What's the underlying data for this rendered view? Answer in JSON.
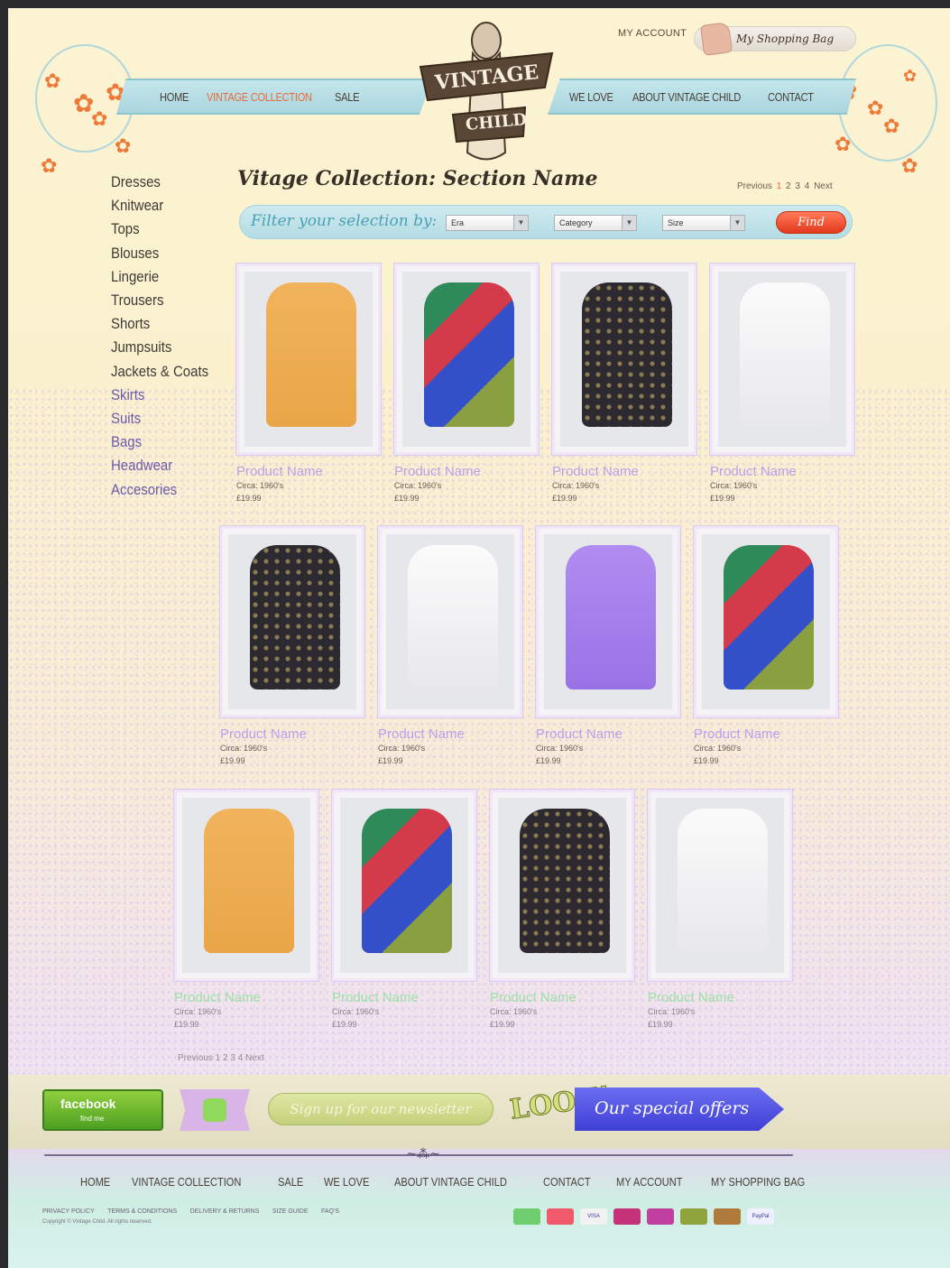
{
  "header": {
    "my_account": "MY ACCOUNT",
    "shopping_bag": "My Shopping Bag",
    "logo_top": "VINTAGE",
    "logo_bottom": "CHILD"
  },
  "nav_left": [
    {
      "label": "HOME",
      "active": false
    },
    {
      "label": "VINTAGE COLLECTION",
      "active": true
    },
    {
      "label": "SALE",
      "active": false
    }
  ],
  "nav_right": [
    {
      "label": "WE LOVE"
    },
    {
      "label": "ABOUT VINTAGE CHILD"
    },
    {
      "label": "CONTACT"
    }
  ],
  "sidebar": {
    "items": [
      "Dresses",
      "Knitwear",
      "Tops",
      "Blouses",
      "Lingerie",
      "Trousers",
      "Shorts",
      "Jumpsuits",
      "Jackets & Coats",
      "Skirts",
      "Suits",
      "Bags",
      "Headwear",
      "Accesories"
    ]
  },
  "main": {
    "title": "Vitage Collection: Section Name",
    "pager": {
      "prev": "Previous",
      "pages": [
        "1",
        "2",
        "3",
        "4"
      ],
      "current": "1",
      "next": "Next"
    }
  },
  "filter": {
    "label": "Filter your selection by:",
    "era": "Era",
    "category": "Category",
    "size": "Size",
    "find": "Find"
  },
  "products": {
    "row1": [
      {
        "name": "Product Name",
        "circa": "Circa: 1960's",
        "price": "£19.99",
        "garment": "mustard"
      },
      {
        "name": "Product Name",
        "circa": "Circa: 1960's",
        "price": "£19.99",
        "garment": "patchwork"
      },
      {
        "name": "Product Name",
        "circa": "Circa: 1960's",
        "price": "£19.99",
        "garment": "black-floral"
      },
      {
        "name": "Product Name",
        "circa": "Circa: 1960's",
        "price": "£19.99",
        "garment": "white"
      }
    ],
    "row2": [
      {
        "name": "Product Name",
        "circa": "Circa: 1960's",
        "price": "£19.99",
        "garment": "black-floral"
      },
      {
        "name": "Product Name",
        "circa": "Circa: 1960's",
        "price": "£19.99",
        "garment": "white"
      },
      {
        "name": "Product Name",
        "circa": "Circa: 1960's",
        "price": "£19.99",
        "garment": "lilac"
      },
      {
        "name": "Product Name",
        "circa": "Circa: 1960's",
        "price": "£19.99",
        "garment": "patchwork"
      }
    ],
    "row3": [
      {
        "name": "Product Name",
        "circa": "Circa: 1960's",
        "price": "£19.99",
        "garment": "mustard"
      },
      {
        "name": "Product Name",
        "circa": "Circa: 1960's",
        "price": "£19.99",
        "garment": "patchwork"
      },
      {
        "name": "Product Name",
        "circa": "Circa: 1960's",
        "price": "£19.99",
        "garment": "black-floral"
      },
      {
        "name": "Product Name",
        "circa": "Circa: 1960's",
        "price": "£19.99",
        "garment": "white"
      }
    ]
  },
  "bottom_pager": "Previous 1 2 3 4 Next",
  "footer": {
    "facebook": "facebook",
    "facebook_sub": "find me",
    "newsletter": "Sign up for our newsletter",
    "look": "LOOK!",
    "offers": "Our special offers",
    "nav": [
      "HOME",
      "VINTAGE COLLECTION",
      "SALE",
      "WE LOVE",
      "ABOUT VINTAGE CHILD",
      "CONTACT",
      "MY ACCOUNT",
      "MY SHOPPING BAG"
    ],
    "links": [
      "PRIVACY POLICY",
      "TERMS & CONDITIONS",
      "DELIVERY & RETURNS",
      "SIZE GUIDE",
      "FAQ'S"
    ],
    "copyright": "Copyright © Vintage Child. All rights reserved.",
    "payments": [
      {
        "name": "maestro",
        "color": "#6fcf6f"
      },
      {
        "name": "mastercard",
        "color": "#f05a6a"
      },
      {
        "name": "VISA",
        "color": "#f2f2f2"
      },
      {
        "name": "card",
        "color": "#c4327a"
      },
      {
        "name": "card",
        "color": "#c13fa0"
      },
      {
        "name": "card",
        "color": "#8fa43c"
      },
      {
        "name": "card",
        "color": "#b07a3a"
      },
      {
        "name": "PayPal",
        "color": "#eef0ff"
      }
    ]
  },
  "colors": {
    "accent": "#e86a3a",
    "ribbon": "#b8dfe6",
    "product_name": "#b9a0ec"
  }
}
